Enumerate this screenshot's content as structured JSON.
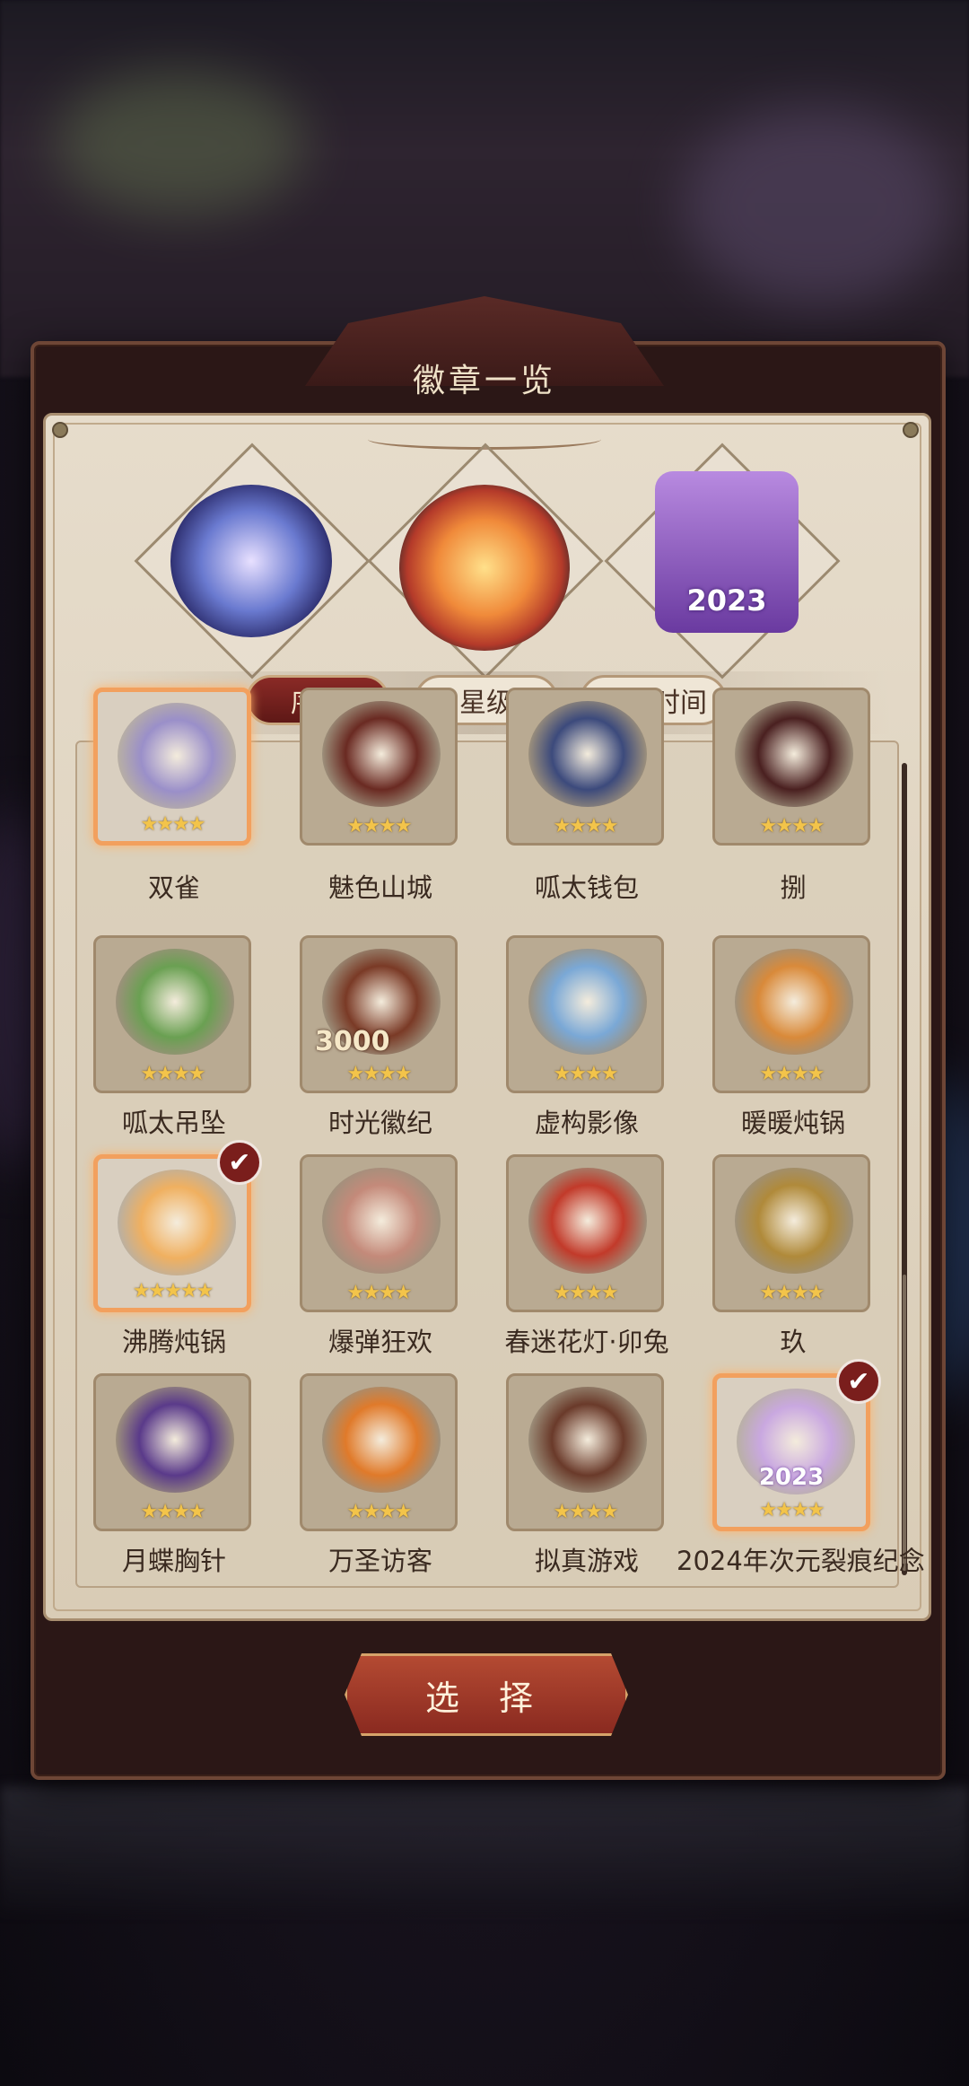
{
  "dialog": {
    "title": "徽章一览"
  },
  "featured": [
    {
      "icon": "twin-sparrow-badge-icon"
    },
    {
      "icon": "hotpot-badge-icon"
    },
    {
      "icon": "rift-2023-badge-icon",
      "year": "2023"
    }
  ],
  "sort_tabs": [
    {
      "label": "序号",
      "active": true
    },
    {
      "label": "星级",
      "active": false
    },
    {
      "label": "入手时间",
      "active": false
    }
  ],
  "badges": [
    {
      "name": "双雀",
      "stars": "★★★★",
      "selected": true,
      "checked": false,
      "color": "#9a8fc9"
    },
    {
      "name": "魅色山城",
      "stars": "★★★★",
      "selected": false,
      "checked": false,
      "color": "#6a2a22"
    },
    {
      "name": "呱太钱包",
      "stars": "★★★★",
      "selected": false,
      "checked": false,
      "color": "#3c4a7c"
    },
    {
      "name": "捌",
      "stars": "★★★★",
      "selected": false,
      "checked": false,
      "color": "#4a2020"
    },
    {
      "name": "呱太吊坠",
      "stars": "★★★★",
      "selected": false,
      "checked": false,
      "color": "#6aa052"
    },
    {
      "name": "时光徽纪",
      "stars": "★★★★",
      "selected": false,
      "checked": false,
      "color": "#7a3a26",
      "number": "3000"
    },
    {
      "name": "虚构影像",
      "stars": "★★★★",
      "selected": false,
      "checked": false,
      "color": "#7aa8d6"
    },
    {
      "name": "暖暖炖锅",
      "stars": "★★★★",
      "selected": false,
      "checked": false,
      "color": "#d98a3a"
    },
    {
      "name": "沸腾炖锅",
      "stars": "★★★★★",
      "selected": true,
      "checked": true,
      "color": "#f0b060"
    },
    {
      "name": "爆弹狂欢",
      "stars": "★★★★",
      "selected": false,
      "checked": false,
      "color": "#c48a7a"
    },
    {
      "name": "春迷花灯·卯兔",
      "stars": "★★★★",
      "selected": false,
      "checked": false,
      "color": "#c23a2a"
    },
    {
      "name": "玖",
      "stars": "★★★★",
      "selected": false,
      "checked": false,
      "color": "#b08a3a"
    },
    {
      "name": "月蝶胸针",
      "stars": "★★★★",
      "selected": false,
      "checked": false,
      "color": "#5a3a8a"
    },
    {
      "name": "万圣访客",
      "stars": "★★★★",
      "selected": false,
      "checked": false,
      "color": "#e07a2a"
    },
    {
      "name": "拟真游戏",
      "stars": "★★★★",
      "selected": false,
      "checked": false,
      "color": "#6a3a2a"
    },
    {
      "name": "2024年次元裂痕纪念",
      "stars": "★★★★",
      "selected": true,
      "checked": true,
      "color": "#c9a8e0",
      "year": "2023"
    }
  ],
  "actions": {
    "select_label": "选 择"
  },
  "check_mark": "✔"
}
